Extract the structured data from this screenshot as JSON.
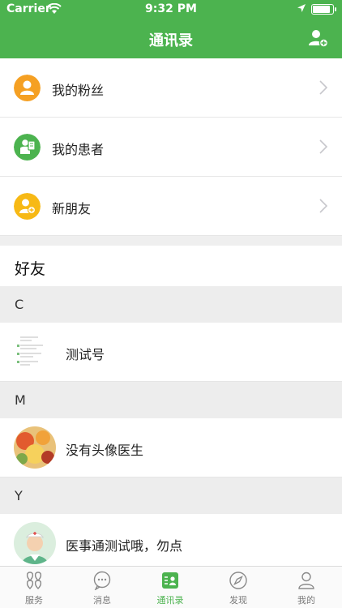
{
  "status_bar": {
    "carrier": "Carrier",
    "time": "9:32 PM"
  },
  "header": {
    "title": "通讯录",
    "add_icon": "add-contact-icon"
  },
  "menu": [
    {
      "label": "我的粉丝",
      "icon": "fans-icon",
      "color": "#f5a023"
    },
    {
      "label": "我的患者",
      "icon": "patients-icon",
      "color": "#4cb34f"
    },
    {
      "label": "新朋友",
      "icon": "new-friend-icon",
      "color": "#f7b915"
    }
  ],
  "friends": {
    "title": "好友",
    "sections": [
      {
        "letter": "C",
        "contacts": [
          {
            "name": "测试号"
          }
        ]
      },
      {
        "letter": "M",
        "contacts": [
          {
            "name": "没有头像医生"
          }
        ]
      },
      {
        "letter": "Y",
        "contacts": [
          {
            "name": "医事通测试哦，勿点"
          }
        ]
      }
    ]
  },
  "tabbar": {
    "active": "通讯录",
    "accent": "#4cb34f",
    "items": [
      {
        "label": "服务",
        "icon": "services-icon"
      },
      {
        "label": "消息",
        "icon": "messages-icon"
      },
      {
        "label": "通讯录",
        "icon": "contacts-icon"
      },
      {
        "label": "发现",
        "icon": "discover-icon"
      },
      {
        "label": "我的",
        "icon": "profile-icon"
      }
    ]
  }
}
